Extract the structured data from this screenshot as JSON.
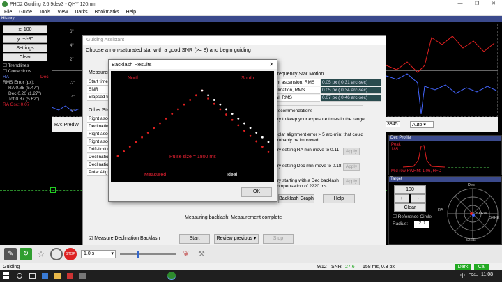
{
  "window": {
    "title": "PHD2 Guiding 2.6.9dev3 - QHY 120mm",
    "minimize": "—",
    "maximize": "❐",
    "close": "✕"
  },
  "menu": [
    "File",
    "Guide",
    "Tools",
    "View",
    "Darks",
    "Bookmarks",
    "Help"
  ],
  "history": {
    "header": "History",
    "x_select": "x: 100",
    "y_select": "y: +/-8\"",
    "settings": "Settings",
    "clear": "Clear",
    "trendlines": "Trendlines",
    "corrections": "Corrections",
    "ra_label": "RA",
    "dec_label": "Dec",
    "rms_header": "RMS Error (px):",
    "ra_rms": "RA 0.85 (5.47\")",
    "dec_rms": "Dec 0.20 (1.27\")",
    "tot_rms": "Tot 0.87 (5.62\")",
    "ra_osc": "RA Osc: 0.07",
    "y_ticks": [
      "6\"",
      "4\"",
      "2\"",
      "-2\"",
      "-4\"",
      "-6\""
    ],
    "ra_predw": "RA: PredW",
    "field_val": "3845",
    "auto_select": "Auto"
  },
  "guiding_assistant": {
    "title": "Guiding Assistant",
    "instruction": "Choose a non-saturated star with a good SNR (>= 8) and begin guiding",
    "measurement_header": "Measurement",
    "meas_rows": [
      "Start time",
      "SNR",
      "Elapsed time"
    ],
    "other_header": "Other Stat",
    "other_rows": [
      "Right ascension",
      "Declination",
      "Right ascension",
      "Right ascension",
      "Drift-limiting",
      "Declination",
      "Declination",
      "Polar Alignment"
    ],
    "hf_header": "High-frequency Star Motion",
    "hf_rows": [
      {
        "label": "Right ascension, RMS",
        "value": "0.05 px ( 0.31 arc-sec)"
      },
      {
        "label": "Declination, RMS",
        "value": "0.05 px ( 0.34 arc-sec)"
      },
      {
        "label": "Total, RMS",
        "value": "0.07 px ( 0.46 arc-sec)"
      }
    ],
    "rec_header": "Recommendations",
    "rec_rows": [
      "Try to keep your exposure times in the range",
      "Polar alignment error > 5 arc-min; that could",
      "probably be improved.",
      "Try setting RA min-move to 0.11",
      "Try setting Dec min-move to 0.18",
      "Try starting with a Dec backlash",
      "compensation of 2220 ms"
    ],
    "apply": "Apply",
    "backlash_graph": "Backlash Graph",
    "help": "Help",
    "status": "Measuring backlash: Measurement complete",
    "measure_dec_backlash": "Measure Declination Backlash",
    "start": "Start",
    "review_previous": "Review previous",
    "stop": "Stop"
  },
  "backlash": {
    "title": "Backlash Results",
    "north": "North",
    "south": "South",
    "pulse_size": "Pulse size = 1800 ms",
    "measured": "Measured",
    "ideal": "Ideal",
    "ok": "OK",
    "close": "✕"
  },
  "dec_profile": {
    "header": "Dec Profile",
    "peak": "Peak",
    "peak_val": "185",
    "fwhm": "Mid row FWHM: 1.06, HFD"
  },
  "target": {
    "header": "Target",
    "zoom": "100",
    "plus": "+",
    "minus": "-",
    "clear": "Clear",
    "ref_circle": "Reference Circle",
    "radius_label": "Radius:",
    "radius_value": "2.0",
    "dec_label": "Dec",
    "ra_label": "RA",
    "labels": [
      "5XHE",
      "5XEE",
      "5XEW"
    ]
  },
  "toolbar": {
    "exposure": "1.0 s"
  },
  "status": {
    "mode": "Guiding",
    "frame": "9/12",
    "snr_label": "SNR",
    "snr_value": "27.6",
    "timing": "158 ms, 0.3 px",
    "dark": "Dark",
    "cal": "Cal"
  },
  "taskbar": {
    "ime": "中",
    "time": "11:08",
    "ampm": "下午"
  },
  "chart_data": {
    "type": "scatter",
    "series": [
      {
        "name": "Measured",
        "color": "#e02020",
        "values": [
          [
            0,
            2
          ],
          [
            1,
            9
          ],
          [
            2,
            16
          ],
          [
            3,
            23
          ],
          [
            4,
            30
          ],
          [
            5,
            37
          ],
          [
            6,
            44
          ],
          [
            7,
            51
          ],
          [
            8,
            58
          ],
          [
            9,
            65
          ],
          [
            10,
            72
          ],
          [
            11,
            79
          ],
          [
            12,
            86
          ],
          [
            13,
            93
          ],
          [
            14,
            100
          ],
          [
            15,
            88
          ],
          [
            16,
            80
          ],
          [
            17,
            72
          ],
          [
            18,
            64
          ],
          [
            19,
            56
          ],
          [
            20,
            48
          ],
          [
            21,
            40
          ],
          [
            22,
            32
          ],
          [
            23,
            24
          ],
          [
            24,
            16
          ],
          [
            25,
            8
          ]
        ]
      },
      {
        "name": "Ideal",
        "color": "#ffffff",
        "values": [
          [
            14,
            100
          ],
          [
            15,
            93
          ],
          [
            16,
            86
          ],
          [
            17,
            79
          ],
          [
            18,
            72
          ],
          [
            19,
            65
          ],
          [
            20,
            58
          ],
          [
            21,
            51
          ],
          [
            22,
            44
          ],
          [
            23,
            37
          ],
          [
            24,
            30
          ],
          [
            25,
            23
          ]
        ]
      }
    ]
  }
}
